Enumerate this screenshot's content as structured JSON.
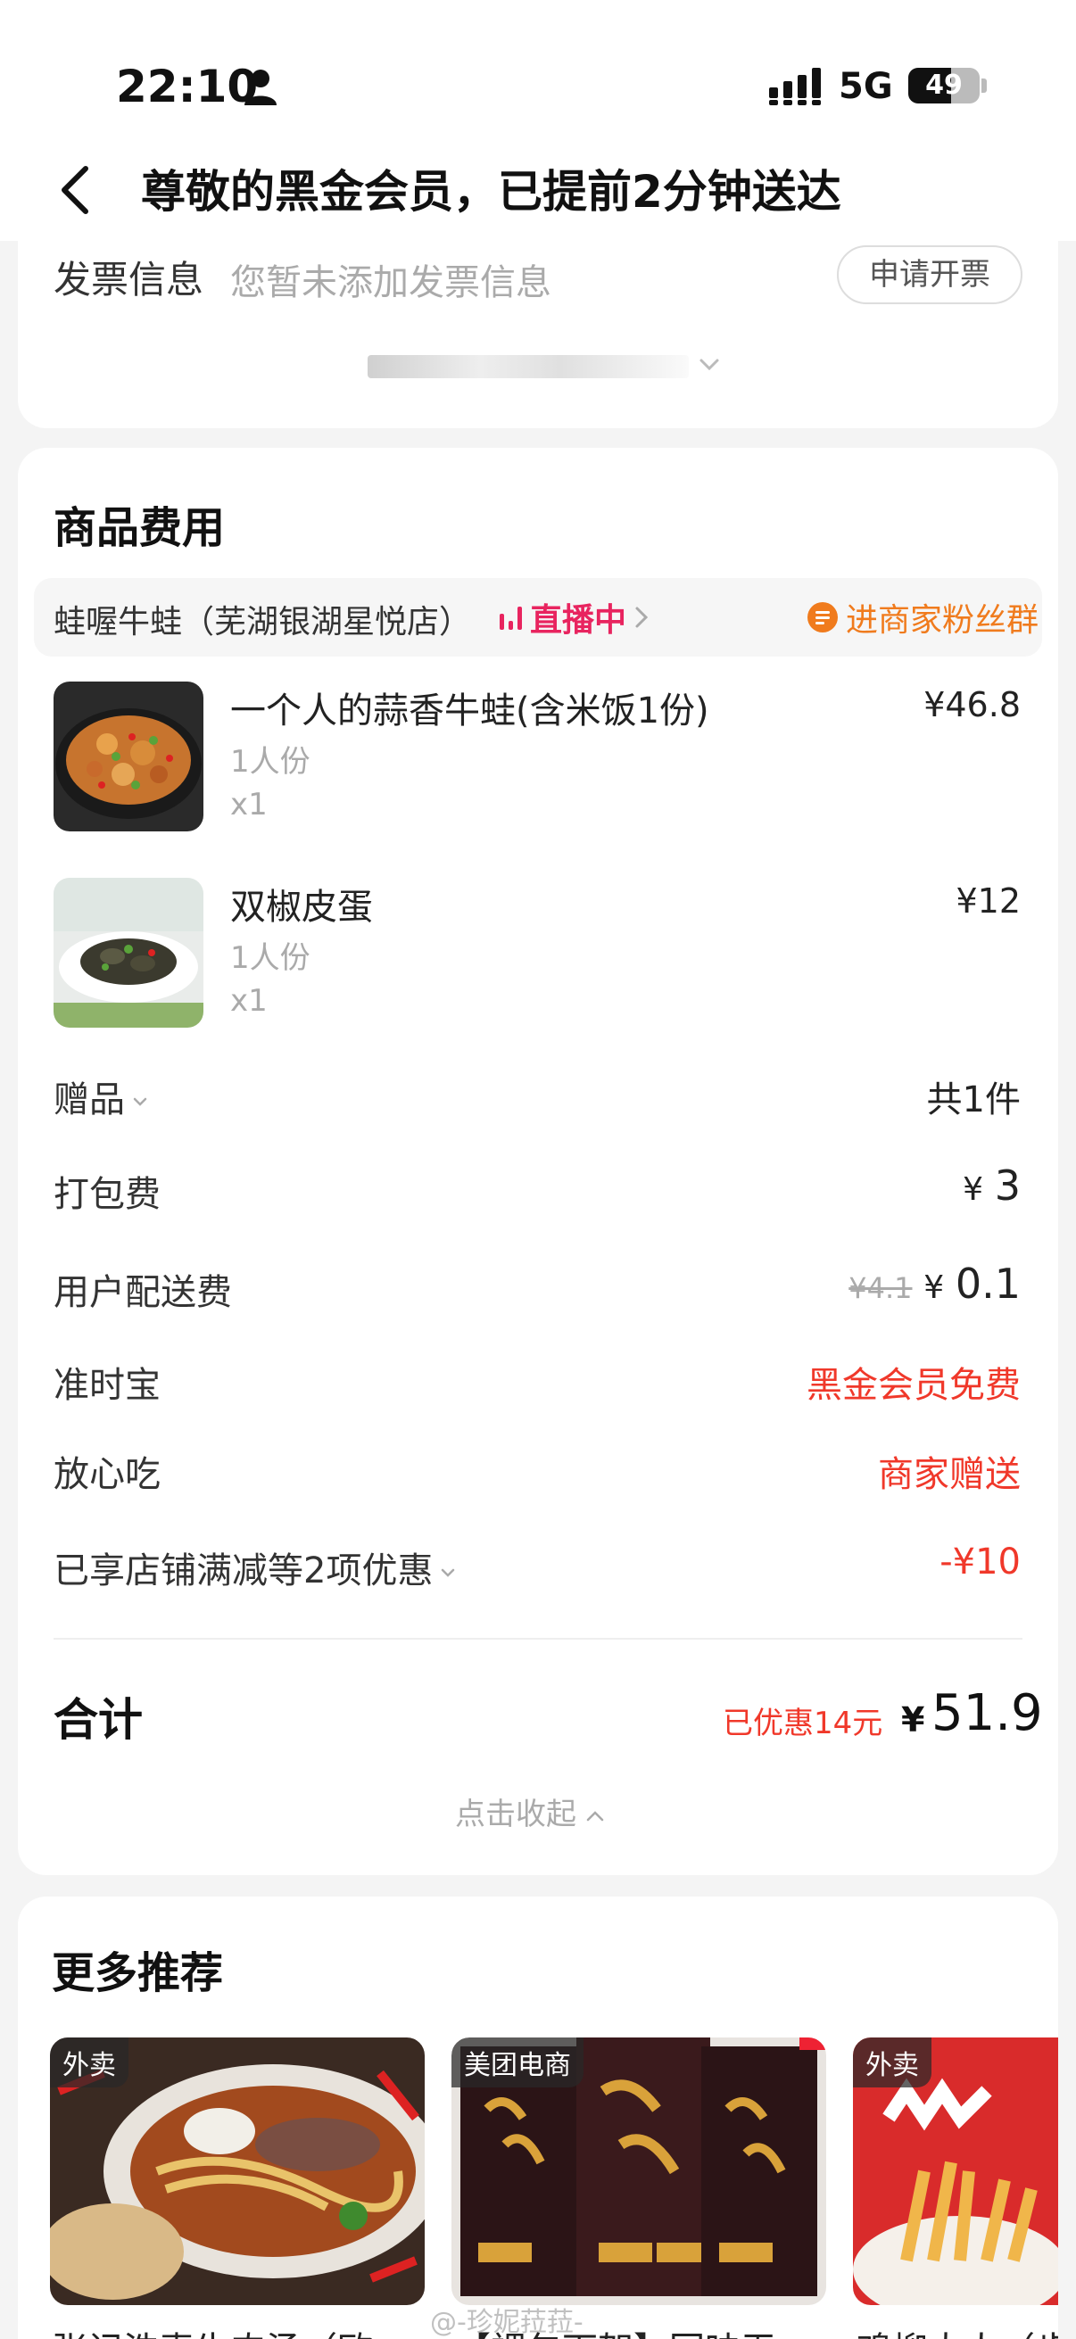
{
  "status_bar": {
    "time": "22:10",
    "network": "5G",
    "battery": "49"
  },
  "nav": {
    "title": "尊敬的黑金会员，已提前2分钟送达"
  },
  "invoice": {
    "label": "发票信息",
    "value": "您暂未添加发票信息",
    "button": "申请开票"
  },
  "goods": {
    "section_title": "商品费用",
    "store": {
      "name": "蛙喔牛蛙（芜湖银湖星悦店）",
      "live_label": "直播中",
      "fans_label": "进商家粉丝群"
    },
    "items": [
      {
        "name": "一个人的蒜香牛蛙(含米饭1份)",
        "spec": "1人份",
        "qty": "x1",
        "price": "¥46.8"
      },
      {
        "name": "双椒皮蛋",
        "spec": "1人份",
        "qty": "x1",
        "price": "¥12"
      }
    ],
    "gift": {
      "label": "赠品",
      "value": "共1件"
    },
    "packing": {
      "label": "打包费",
      "yen": "¥",
      "value": "3"
    },
    "delivery": {
      "label": "用户配送费",
      "original": "¥4.1",
      "yen": "¥",
      "value": "0.1"
    },
    "ontime": {
      "label": "准时宝",
      "value": "黑金会员免费"
    },
    "safe": {
      "label": "放心吃",
      "value": "商家赠送"
    },
    "discount": {
      "label": "已享店铺满减等2项优惠",
      "value": "-¥10"
    },
    "total": {
      "label": "合计",
      "saved": "已优惠14元",
      "yen": "¥",
      "value": "51.9"
    },
    "collapse": "点击收起"
  },
  "more": {
    "title": "更多推荐",
    "cards": [
      {
        "tag": "外卖",
        "title": "张记浩麦牛肉汤（欧"
      },
      {
        "tag": "美团电商",
        "title": "【裸包下架】回味无"
      },
      {
        "tag": "外卖",
        "title": "鸡柳大人（步"
      }
    ]
  },
  "watermark": "@-珍妮菈菈-",
  "colors": {
    "accent_red": "#f0382a",
    "live_pink": "#e8245f",
    "fans_orange": "#f07b1d",
    "background": "#f4f4f4"
  }
}
